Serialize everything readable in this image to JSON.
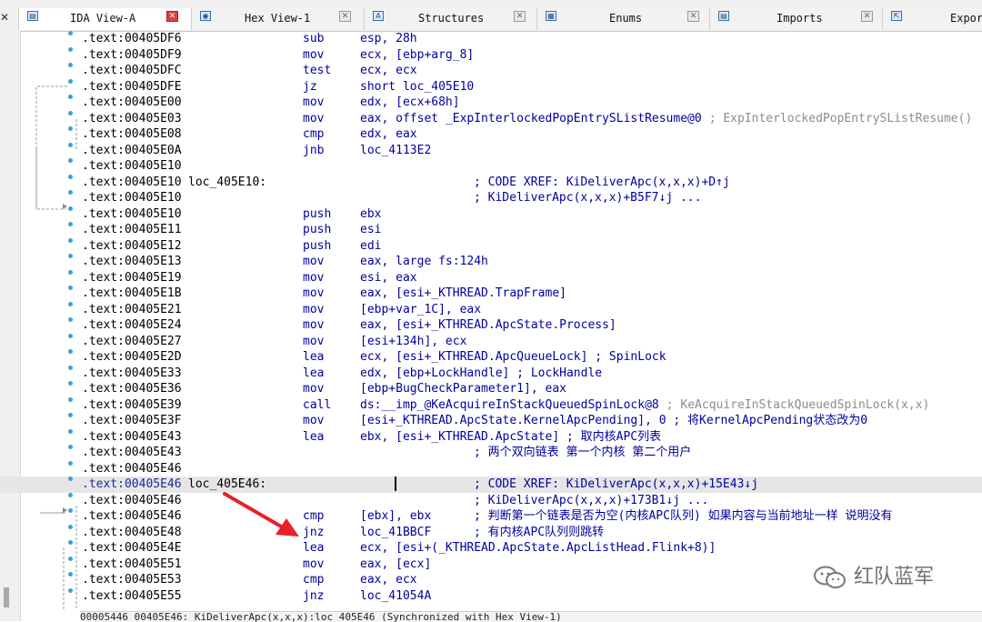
{
  "tabs": [
    {
      "label": "IDA View-A",
      "icon": "listing-icon",
      "icon_glyph": "▤",
      "active": true
    },
    {
      "label": "Hex View-1",
      "icon": "hex-icon",
      "icon_glyph": "◉",
      "active": false
    },
    {
      "label": "Structures",
      "icon": "structures-icon",
      "icon_glyph": "A",
      "active": false
    },
    {
      "label": "Enums",
      "icon": "enums-icon",
      "icon_glyph": "▦",
      "active": false
    },
    {
      "label": "Imports",
      "icon": "imports-icon",
      "icon_glyph": "▤",
      "active": false
    },
    {
      "label": "Expor",
      "icon": "exports-icon",
      "icon_glyph": "⇱",
      "active": false
    }
  ],
  "close_glyph": "✕",
  "left_close_glyph": "✕",
  "listing": [
    {
      "addr": ".text:00405DF6",
      "mnem": "sub",
      "ops": "esp, 28h"
    },
    {
      "addr": ".text:00405DF9",
      "mnem": "mov",
      "ops": "ecx, [ebp+arg_8]"
    },
    {
      "addr": ".text:00405DFC",
      "mnem": "test",
      "ops": "ecx, ecx"
    },
    {
      "addr": ".text:00405DFE",
      "mnem": "jz",
      "ops": "short loc_405E10"
    },
    {
      "addr": ".text:00405E00",
      "mnem": "mov",
      "ops": "edx, [ecx+68h]"
    },
    {
      "addr": ".text:00405E03",
      "mnem": "mov",
      "ops": "eax, offset _ExpInterlockedPopEntrySListResume@0",
      "ops_comment": "; ExpInterlockedPopEntrySListResume()"
    },
    {
      "addr": ".text:00405E08",
      "mnem": "cmp",
      "ops": "edx, eax"
    },
    {
      "addr": ".text:00405E0A",
      "mnem": "jnb",
      "ops": "loc_4113E2"
    },
    {
      "addr": ".text:00405E10"
    },
    {
      "addr": ".text:00405E10",
      "label": "loc_405E10:",
      "comment": "; CODE XREF: KiDeliverApc(x,x,x)+D↑j"
    },
    {
      "addr": ".text:00405E10",
      "comment": "; KiDeliverApc(x,x,x)+B5F7↓j ..."
    },
    {
      "addr": ".text:00405E10",
      "mnem": "push",
      "ops": "ebx"
    },
    {
      "addr": ".text:00405E11",
      "mnem": "push",
      "ops": "esi"
    },
    {
      "addr": ".text:00405E12",
      "mnem": "push",
      "ops": "edi"
    },
    {
      "addr": ".text:00405E13",
      "mnem": "mov",
      "ops": "eax, large fs:124h"
    },
    {
      "addr": ".text:00405E19",
      "mnem": "mov",
      "ops": "esi, eax"
    },
    {
      "addr": ".text:00405E1B",
      "mnem": "mov",
      "ops": "eax, [esi+_KTHREAD.TrapFrame]"
    },
    {
      "addr": ".text:00405E21",
      "mnem": "mov",
      "ops": "[ebp+var_1C], eax"
    },
    {
      "addr": ".text:00405E24",
      "mnem": "mov",
      "ops": "eax, [esi+_KTHREAD.ApcState.Process]"
    },
    {
      "addr": ".text:00405E27",
      "mnem": "mov",
      "ops": "[esi+134h], ecx"
    },
    {
      "addr": ".text:00405E2D",
      "mnem": "lea",
      "ops": "ecx, [esi+_KTHREAD.ApcQueueLock] ; SpinLock"
    },
    {
      "addr": ".text:00405E33",
      "mnem": "lea",
      "ops": "edx, [ebp+LockHandle] ; LockHandle"
    },
    {
      "addr": ".text:00405E36",
      "mnem": "mov",
      "ops": "[ebp+BugCheckParameter1], eax"
    },
    {
      "addr": ".text:00405E39",
      "mnem": "call",
      "ops": "ds:__imp_@KeAcquireInStackQueuedSpinLock@8",
      "ops_comment": "; KeAcquireInStackQueuedSpinLock(x,x)"
    },
    {
      "addr": ".text:00405E3F",
      "mnem": "mov",
      "ops": "[esi+_KTHREAD.ApcState.KernelApcPending], 0 ; 将KernelApcPending状态改为0"
    },
    {
      "addr": ".text:00405E43",
      "mnem": "lea",
      "ops": "ebx, [esi+_KTHREAD.ApcState] ; 取内核APC列表"
    },
    {
      "addr": ".text:00405E43",
      "comment": "; 两个双向链表 第一个内核 第二个用户"
    },
    {
      "addr": ".text:00405E46"
    },
    {
      "addr": ".text:00405E46",
      "label": "loc_405E46:",
      "comment": "; CODE XREF: KiDeliverApc(x,x,x)+15E43↓j",
      "highlight": true
    },
    {
      "addr": ".text:00405E46",
      "comment": "; KiDeliverApc(x,x,x)+173B1↓j ..."
    },
    {
      "addr": ".text:00405E46",
      "mnem": "cmp",
      "ops": "[ebx], ebx",
      "comment": "; 判断第一个链表是否为空(内核APC队列) 如果内容与当前地址一样 说明没有"
    },
    {
      "addr": ".text:00405E48",
      "mnem": "jnz",
      "ops": "loc_41BBCF",
      "comment": "; 有内核APC队列则跳转"
    },
    {
      "addr": ".text:00405E4E",
      "mnem": "lea",
      "ops": "ecx, [esi+(_KTHREAD.ApcState.ApcListHead.Flink+8)]"
    },
    {
      "addr": ".text:00405E51",
      "mnem": "mov",
      "ops": "eax, [ecx]"
    },
    {
      "addr": ".text:00405E53",
      "mnem": "cmp",
      "ops": "eax, ecx"
    },
    {
      "addr": ".text:00405E55",
      "mnem": "jnz",
      "ops": "loc_41054A"
    }
  ],
  "status_bar": "00005446 00405E46: KiDeliverApc(x,x,x):loc_405E46 (Synchronized with Hex View-1)",
  "watermark": {
    "text": "红队蓝军",
    "logo_icon": "wechat-logo-icon"
  },
  "colors": {
    "code": "#0000a0",
    "comment_gray": "#8c8c8c",
    "dot": "#3aa0e0",
    "highlight": "#e6e6e6",
    "arrow": "#e8202a"
  }
}
